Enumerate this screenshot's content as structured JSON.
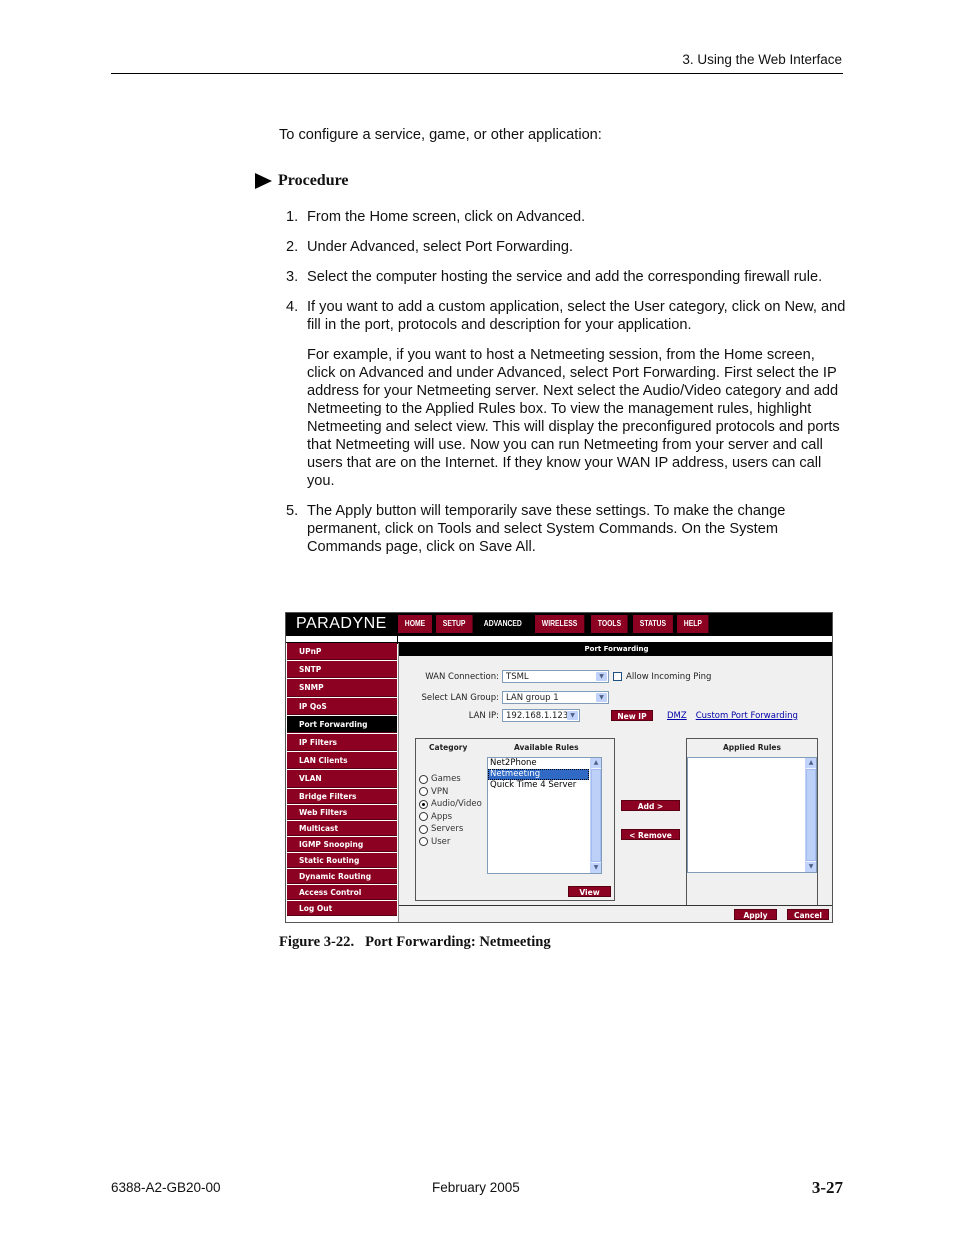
{
  "header": {
    "running_head": "3. Using the Web Interface"
  },
  "intro": "To configure a service, game, or other application:",
  "procedure": {
    "heading": "Procedure",
    "steps": [
      {
        "num": "1.",
        "text": "From the Home screen, click on Advanced."
      },
      {
        "num": "2.",
        "text": "Under Advanced, select Port Forwarding."
      },
      {
        "num": "3.",
        "text": "Select the computer hosting the service and add the corresponding firewall rule."
      },
      {
        "num": "4.",
        "text": "If you want to add a custom application, select the User category, click on New, and fill in the port, protocols and description for your application.",
        "example": "For example, if you want to host a Netmeeting session, from the Home screen, click on Advanced and under Advanced, select Port Forwarding. First select the IP address for your Netmeeting server. Next select the Audio/Video category and add Netmeeting to the Applied Rules box. To view the management rules, highlight Netmeeting and select view. This will display the preconfigured protocols and ports that Netmeeting will use.  Now you can run Netmeeting from your server and call users that are on the Internet. If they know your WAN IP address, users can call you."
      },
      {
        "num": "5.",
        "text": "The Apply button will temporarily save these settings. To make the change permanent, click on Tools and select System Commands. On the System Commands page, click on Save All."
      }
    ]
  },
  "ui": {
    "logo": "PARADYNE",
    "tabs": [
      "HOME",
      "SETUP",
      "ADVANCED",
      "WIRELESS",
      "TOOLS",
      "STATUS",
      "HELP"
    ],
    "active_tab": "ADVANCED",
    "sidebar": [
      "UPnP",
      "SNTP",
      "SNMP",
      "IP QoS",
      "Port Forwarding",
      "IP Filters",
      "LAN Clients",
      "VLAN",
      "Bridge Filters",
      "Web Filters",
      "Multicast",
      "IGMP Snooping",
      "Static Routing",
      "Dynamic Routing",
      "Access Control",
      "Log Out"
    ],
    "active_sidebar": "Port Forwarding",
    "panel_title": "Port Forwarding",
    "wan_connection": {
      "label": "WAN Connection:",
      "value": "TSML"
    },
    "allow_ping": {
      "label": "Allow Incoming Ping",
      "checked": false
    },
    "lan_group": {
      "label": "Select LAN Group:",
      "value": "LAN group 1"
    },
    "lan_ip": {
      "label": "LAN IP:",
      "value": "192.168.1.123"
    },
    "new_ip_button": "New IP",
    "dmz_link": "DMZ",
    "custom_pf_link": "Custom Port Forwarding",
    "category_header": "Category",
    "available_header": "Available Rules",
    "applied_header": "Applied Rules",
    "categories": [
      {
        "label": "Games",
        "selected": false
      },
      {
        "label": "VPN",
        "selected": false
      },
      {
        "label": "Audio/Video",
        "selected": true
      },
      {
        "label": "Apps",
        "selected": false
      },
      {
        "label": "Servers",
        "selected": false
      },
      {
        "label": "User",
        "selected": false
      }
    ],
    "available_rules": [
      {
        "label": "Net2Phone",
        "selected": false
      },
      {
        "label": "Netmeeting",
        "selected": true
      },
      {
        "label": "Quick Time 4 Server",
        "selected": false
      }
    ],
    "applied_rules": [],
    "add_button": "Add >",
    "remove_button": "< Remove",
    "view_button": "View",
    "apply_button": "Apply",
    "cancel_button": "Cancel",
    "colors": {
      "accent": "#8c0022",
      "selection": "#316ac5"
    }
  },
  "caption": "Figure 3-22.   Port Forwarding: Netmeeting",
  "footer": {
    "doc_number": "6388-A2-GB20-00",
    "date": "February 2005",
    "page": "3-27"
  }
}
